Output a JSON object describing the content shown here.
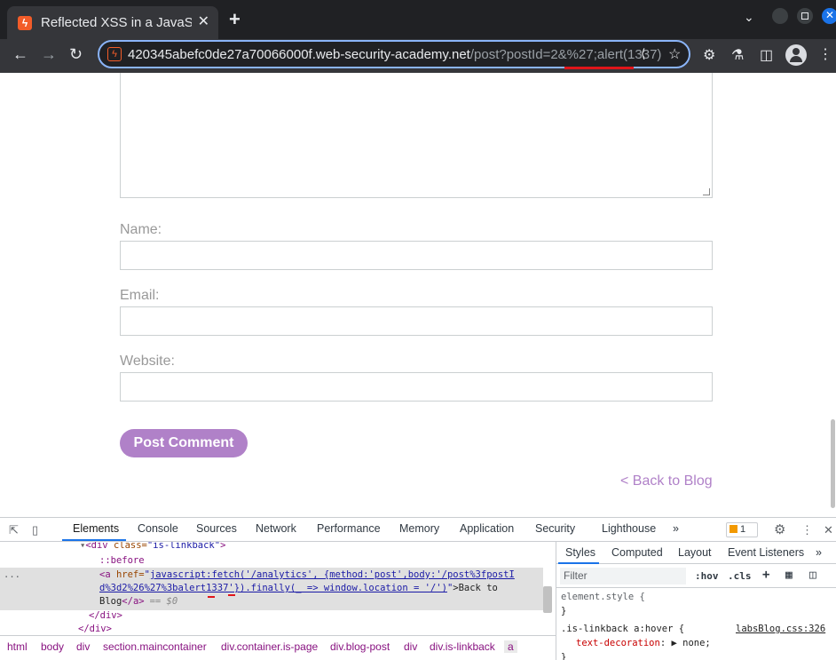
{
  "browser": {
    "tab_title": "Reflected XSS in a JavaScri",
    "tab_favicon": "ϟ",
    "close_glyph": "✕",
    "newtab_glyph": "+",
    "url_host": "420345abefc0de27a70066000f.web-security-academy.net",
    "url_path_plain": "/post?postId=2&%27;",
    "url_path_hl": "alert(1337)",
    "underline_color": "#e0151a"
  },
  "form": {
    "name_label": "Name:",
    "email_label": "Email:",
    "website_label": "Website:",
    "submit_label": "Post Comment",
    "back_link": "< Back to Blog",
    "accent_color": "#b081c8"
  },
  "devtools": {
    "tabs": [
      "Elements",
      "Console",
      "Sources",
      "Network",
      "Performance",
      "Memory",
      "Application",
      "Security",
      "Lighthouse"
    ],
    "more": "»",
    "issues_count": "1",
    "elements": {
      "div_open_tag": "<div ",
      "div_class_attr": "class=",
      "div_class_val": "\"is-linkback\"",
      "div_open_close": ">",
      "pseudo_before": "::before",
      "a_open": "<a ",
      "href_attr": "href=",
      "href_quote_open": "\"",
      "href_line1": "javascript:fetch('/analytics', {method:'post',body:'/post%3fpostI",
      "href_line2": "d%3d2%26%27%3balert1337'}).finally(_ => window.location = '/')",
      "href_quote_close": "\"",
      "a_text_1": ">Back to",
      "a_text_2": "Blog",
      "a_close": "</a>",
      "eq_dollar": "== $0",
      "div_close": "</div>",
      "div_close2": "</div>",
      "ellipsis": "..."
    },
    "styles": {
      "tabs": [
        "Styles",
        "Computed",
        "Layout",
        "Event Listeners"
      ],
      "more": "»",
      "filter_placeholder": "Filter",
      "hov": ":hov",
      "cls": ".cls",
      "plus": "+",
      "rule1_selector": "element.style {",
      "rule1_close": "}",
      "rule2_selector": ".is-linkback a:hover {",
      "rule2_source": "labsBlog.css:326",
      "rule2_prop": "text-decoration",
      "rule2_colon": ":",
      "rule2_value": "▶ none;"
    },
    "breadcrumbs": [
      "html",
      "body",
      "div",
      "section.maincontainer",
      "div.container.is-page",
      "div.blog-post",
      "div",
      "div.is-linkback",
      "a"
    ]
  }
}
